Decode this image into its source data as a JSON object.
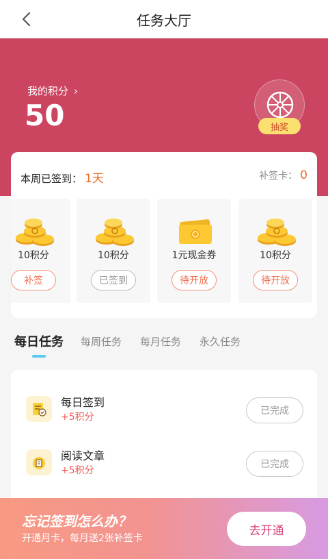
{
  "header": {
    "title": "任务大厅"
  },
  "hero": {
    "points_label": "我的积分",
    "points_value": "50",
    "lottery_label": "抽奖"
  },
  "signin": {
    "week_label": "本周已签到：",
    "week_value": "1天",
    "card_label": "补签卡：",
    "card_value": "0",
    "days": [
      {
        "label": "10积分",
        "icon": "coins-icon",
        "button": "补签",
        "state": "makeup"
      },
      {
        "label": "10积分",
        "icon": "coins-icon",
        "button": "已签到",
        "state": "done"
      },
      {
        "label": "1元现金券",
        "icon": "cash-voucher-icon",
        "button": "待开放",
        "state": "pending"
      },
      {
        "label": "10积分",
        "icon": "coins-icon",
        "button": "待开放",
        "state": "pending"
      }
    ]
  },
  "tabs": [
    {
      "label": "每日任务",
      "active": true
    },
    {
      "label": "每周任务",
      "active": false
    },
    {
      "label": "每月任务",
      "active": false
    },
    {
      "label": "永久任务",
      "active": false
    }
  ],
  "tasks": [
    {
      "name": "每日签到",
      "reward": "+5积分",
      "button": "已完成",
      "icon": "checkin-calendar-icon"
    },
    {
      "name": "阅读文章",
      "reward": "+5积分",
      "button": "已完成",
      "icon": "read-article-icon"
    }
  ],
  "promo": {
    "title": "忘记签到怎么办？",
    "subtitle": "开通月卡，每月送2张补签卡",
    "button": "去开通"
  },
  "colors": {
    "brand_red": "#cc4560",
    "accent_orange": "#f06a24",
    "tab_indicator": "#5ccaf0"
  }
}
